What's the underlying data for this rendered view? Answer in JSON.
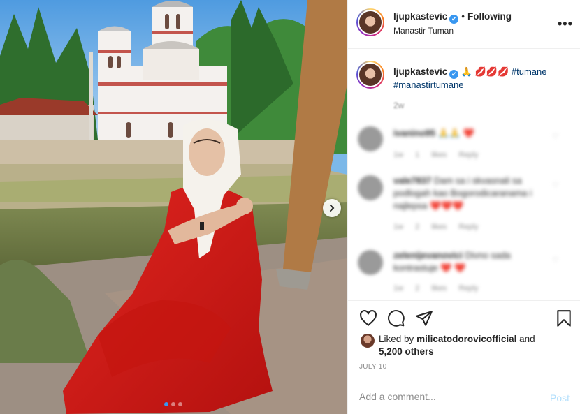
{
  "post": {
    "author": "ljupkastevic",
    "verified_mark": "✔",
    "separator": "•",
    "follow_status": "Following",
    "location": "Manastir Tuman",
    "more_icon": "•••"
  },
  "caption": {
    "author": "ljupkastevic",
    "emoji": "🙏 💋💋💋",
    "hashtags": [
      "#tumane",
      "#manastirtumane"
    ],
    "time": "2w"
  },
  "comments": [
    {
      "user": "ivanino95",
      "text": "🙏🙏 ❤️",
      "meta": [
        "1w",
        "1 likes",
        "Reply"
      ]
    },
    {
      "user": "vale7837",
      "text": "Dam sa i skvasnali sa podlogah kao Bogorodicaranama i najlepsa",
      "emoji": "❤️❤️❤️",
      "meta": [
        "1w",
        "2 likes",
        "Reply"
      ]
    },
    {
      "user": "zelenijevanovici",
      "text": "Divno sada kontrastuje",
      "emoji": "❤️ ❤️",
      "meta": [
        "1w",
        "2 likes",
        "Reply"
      ]
    }
  ],
  "actions": {
    "icons": [
      "heart-icon",
      "comment-icon",
      "share-icon",
      "bookmark-icon"
    ],
    "liked_by_prefix": "Liked by",
    "liked_by_user": "milicatodorovicofficial",
    "liked_by_and": "and",
    "liked_by_count": "5,200 others",
    "date": "JULY 10"
  },
  "add_comment": {
    "placeholder": "Add a comment...",
    "post_label": "Post"
  },
  "carousel": {
    "total": 3,
    "current": 1,
    "next_icon": "chevron-right-icon"
  },
  "colors": {
    "accent": "#3897f0",
    "hashtag": "#00376b",
    "muted": "#8e8e8e",
    "post_disabled": "#b2dffc"
  }
}
